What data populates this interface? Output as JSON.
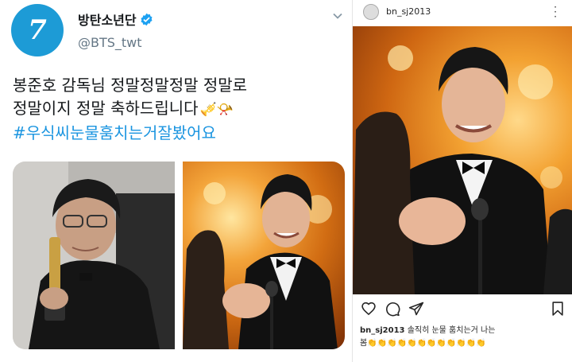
{
  "tweet": {
    "avatar_glyph": "7",
    "name": "방탄소년단",
    "handle": "@BTS_twt",
    "lines": [
      "봉준호 감독님 정말정말정말 정말로",
      "정말이지 정말 축하드립니다"
    ],
    "emojis": "🎺📯",
    "hashtag": "#우식씨눈물훔치는거잘봤어요",
    "accent_color": "#1b95e0",
    "verified_color": "#1da1f2"
  },
  "instagram": {
    "username": "bn_sj2013",
    "more_icon": "ellipsis-vertical-icon",
    "actions": [
      "heart-icon",
      "comment-icon",
      "share-icon",
      "bookmark-icon"
    ],
    "caption_user": "bn_sj2013",
    "caption_text": "솔직히 눈물 훔치는거 나는",
    "caption_line2": "봄👏👏👏👏👏👏👏👏👏👏👏👏"
  }
}
